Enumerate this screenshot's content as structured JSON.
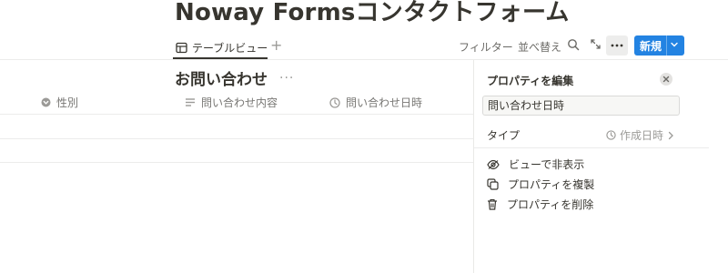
{
  "page": {
    "title": "Noway Formsコンタクトフォーム"
  },
  "toolbar": {
    "view_tab_label": "テーブルビュー",
    "add_view": "+",
    "filter_label": "フィルター",
    "sort_label": "並べ替え",
    "new_label": "新規"
  },
  "table": {
    "title": "お問い合わせ",
    "more": "···",
    "columns": [
      {
        "label": "性別",
        "icon": "select-icon"
      },
      {
        "label": "問い合わせ内容",
        "icon": "text-icon"
      },
      {
        "label": "問い合わせ日時",
        "icon": "clock-icon"
      }
    ]
  },
  "panel": {
    "title": "プロパティを編集",
    "property_name": "問い合わせ日時",
    "type_label": "タイプ",
    "type_value": "作成日時",
    "actions": [
      {
        "label": "ビューで非表示",
        "icon": "eye-icon"
      },
      {
        "label": "プロパティを複製",
        "icon": "duplicate-icon"
      },
      {
        "label": "プロパティを削除",
        "icon": "trash-icon"
      }
    ]
  },
  "colors": {
    "accent": "#2383e2",
    "text": "#37352f",
    "muted": "#787774"
  }
}
